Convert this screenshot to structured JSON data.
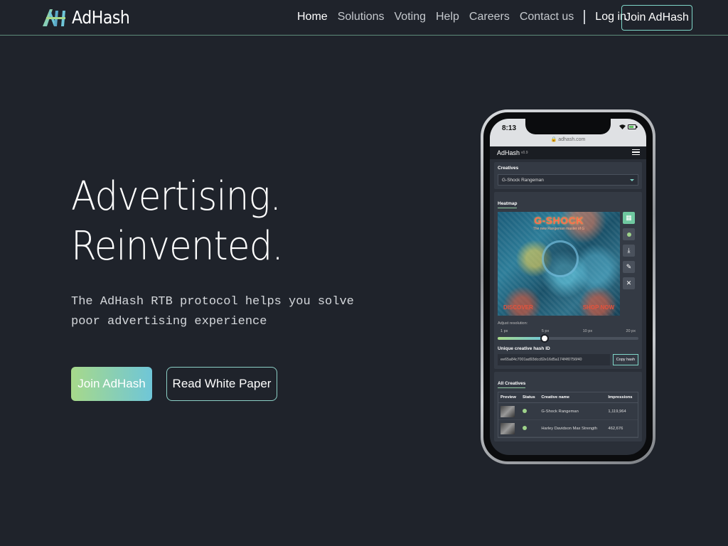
{
  "nav": {
    "logo_text": "AdHash",
    "links": [
      "Home",
      "Solutions",
      "Voting",
      "Help",
      "Careers",
      "Contact us"
    ],
    "login": "Log in",
    "join": "Join AdHash"
  },
  "hero": {
    "title_line1": "Advertising.",
    "title_line2": "Reinvented.",
    "subtitle": "The AdHash RTB protocol helps you solve poor advertising experience",
    "primary_button": "Join AdHash",
    "secondary_button": "Read White Paper"
  },
  "phone": {
    "time": "8:13",
    "url": "🔒 adhash.com",
    "app_logo": "AdHash",
    "app_version": "v0.9",
    "creatives": {
      "title": "Creatives",
      "selected": "G-Shock Rangeman"
    },
    "heatmap": {
      "title": "Heatmap",
      "brand": "G-SHOCK",
      "tagline": "The new Rangeman master of G",
      "cta_left": "DISCOVER",
      "cta_right": "SHOP NOW",
      "resolution_label": "Adjust resolution:",
      "ticks": [
        "1 px",
        "5 px",
        "10 px",
        "20 px"
      ],
      "resolution_index": 1,
      "hash_label": "Unique creative hash ID",
      "hash_value": "ee65a84c7001ad93dcc82e16d5a174f4f0756f40",
      "copy_button": "Copy hash"
    },
    "all_creatives": {
      "title": "All Creatives",
      "columns": [
        "Preview",
        "Status",
        "Creative name",
        "Impressions"
      ],
      "rows": [
        {
          "name": "G-Shock Rangeman",
          "impressions": "1,119,964"
        },
        {
          "name": "Harley Davidson Max Strength",
          "impressions": "462,676"
        }
      ]
    }
  }
}
